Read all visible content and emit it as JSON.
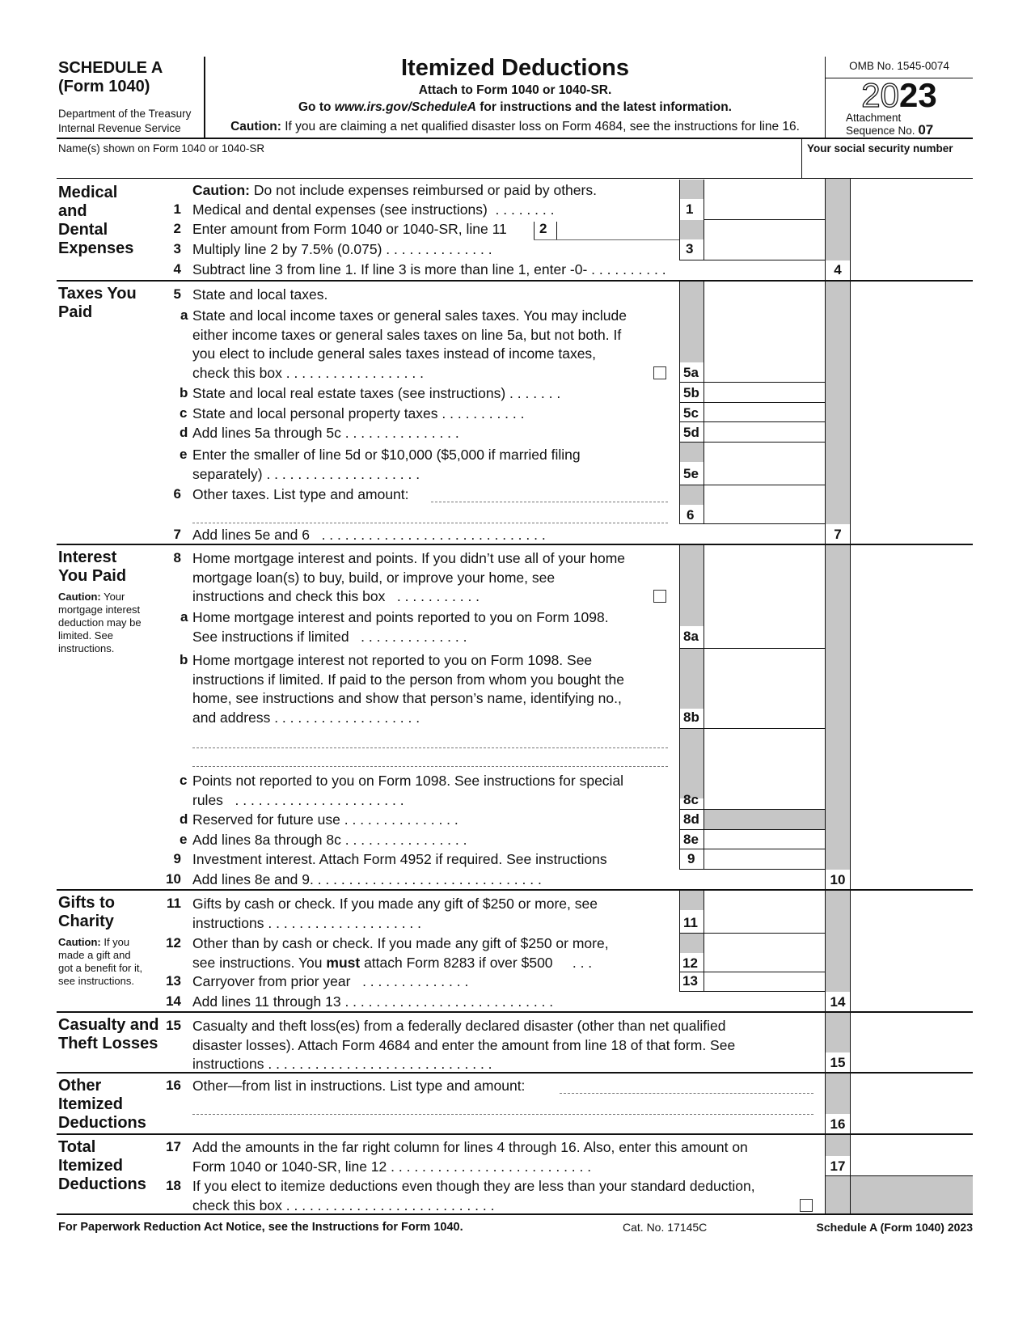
{
  "header": {
    "schedule": "SCHEDULE A",
    "form": "(Form 1040)",
    "dept1": "Department of the Treasury",
    "dept2": "Internal Revenue Service",
    "title": "Itemized Deductions",
    "attach": "Attach to Form 1040 or 1040-SR.",
    "goto_pre": "Go to ",
    "goto_url": "www.irs.gov/ScheduleA",
    "goto_post": " for instructions and the latest information.",
    "caution_label": "Caution:",
    "caution_text": " If you are claiming a net qualified disaster loss on Form 4684, see the instructions for line 16.",
    "omb": "OMB No. 1545-0074",
    "year_outline": "20",
    "year_bold": "23",
    "attachment": "Attachment",
    "sequence_label": "Sequence No.",
    "sequence_no": "07"
  },
  "name_row": {
    "name_label": "Name(s) shown on Form 1040 or 1040-SR",
    "name_value": "",
    "ssn_label": "Your social security number",
    "ssn_value": ""
  },
  "sections": {
    "medical": {
      "title": [
        "Medical",
        "and",
        "Dental",
        "Expenses"
      ],
      "caution_label": "Caution:",
      "caution_text": " Do not include expenses reimbursed or paid by others.",
      "l1": "Medical and dental expenses (see instructions)",
      "l2": "Enter amount from Form 1040 or 1040-SR, line 11",
      "l3": "Multiply line 2 by 7.5% (0.075)",
      "l4": "Subtract line 3 from line 1. If line 3 is more than line 1, enter -0-"
    },
    "taxes": {
      "title": [
        "Taxes You",
        "Paid"
      ],
      "l5": "State and local taxes.",
      "l5a": [
        "State and local income taxes or general sales taxes. You may include",
        "either income taxes or general sales taxes on line 5a, but not both. If",
        "you elect to include general sales taxes instead of income taxes,",
        "check this box"
      ],
      "l5b": "State and local real estate taxes (see instructions)",
      "l5c": "State and local personal property taxes",
      "l5d": "Add lines 5a through 5c",
      "l5e": [
        "Enter the smaller of line 5d or $10,000 ($5,000 if married filing",
        "separately)"
      ],
      "l6": "Other taxes. List type and amount:",
      "l7": "Add lines 5e and 6"
    },
    "interest": {
      "title": [
        "Interest",
        "You Paid"
      ],
      "caution_label": "Caution:",
      "caution_lines": [
        " Your",
        "mortgage interest",
        "deduction may be",
        "limited. See",
        "instructions."
      ],
      "l8": [
        "Home mortgage interest and points. If you didn’t use all of your home",
        "mortgage loan(s) to buy, build, or improve your home, see",
        "instructions and check this box"
      ],
      "l8a": [
        "Home mortgage interest and points reported to you on Form 1098.",
        "See instructions if limited"
      ],
      "l8b": [
        "Home mortgage interest not reported to you on Form 1098. See",
        "instructions if limited. If paid to the person from whom you bought the",
        "home, see instructions and show that person’s name, identifying no.,",
        "and address"
      ],
      "l8c": [
        "Points not reported to you on Form 1098. See instructions for special",
        "rules"
      ],
      "l8d": "Reserved for future use",
      "l8e": "Add lines 8a through 8c",
      "l9": "Investment interest. Attach Form 4952 if required. See instructions",
      "l10": "Add lines 8e and 9"
    },
    "gifts": {
      "title": [
        "Gifts to",
        "Charity"
      ],
      "caution_label": "Caution:",
      "caution_lines": [
        " If you",
        "made a gift and",
        "got a benefit for it,",
        "see instructions."
      ],
      "l11": [
        "Gifts by cash or check. If you made any gift of $250 or more, see",
        "instructions"
      ],
      "l12_a": "Other than by cash or check. If you made any gift of $250 or more,",
      "l12_b_pre": "see instructions. You ",
      "l12_b_bold": "must",
      "l12_b_post": " attach Form 8283 if over $500",
      "l13": "Carryover from prior year",
      "l14": "Add lines 11 through 13"
    },
    "casualty": {
      "title": [
        "Casualty and",
        "Theft Losses"
      ],
      "l15": [
        "Casualty and theft loss(es) from a federally declared disaster (other than net qualified",
        "disaster losses). Attach Form 4684 and enter the amount from line 18 of that form. See",
        "instructions"
      ]
    },
    "other": {
      "title": [
        "Other",
        "Itemized",
        "Deductions"
      ],
      "l16": "Other—from list in instructions. List type and amount:"
    },
    "total": {
      "title": [
        "Total",
        "Itemized",
        "Deductions"
      ],
      "l17": [
        "Add the amounts in the far right column for lines 4 through 16. Also, enter this amount on",
        "Form 1040 or 1040-SR, line 12"
      ],
      "l18": [
        "If you elect to itemize deductions even though they are less than your standard deduction,",
        "check this box"
      ]
    }
  },
  "line_numbers": {
    "n1": "1",
    "n2": "2",
    "n3": "3",
    "n4": "4",
    "n5": "5",
    "n6": "6",
    "n7": "7",
    "n8": "8",
    "n9": "9",
    "n10": "10",
    "n11": "11",
    "n12": "12",
    "n13": "13",
    "n14": "14",
    "n15": "15",
    "n16": "16",
    "n17": "17",
    "n18": "18",
    "a": "a",
    "b": "b",
    "c": "c",
    "d": "d",
    "e": "e",
    "b5a": "5a",
    "b5b": "5b",
    "b5c": "5c",
    "b5d": "5d",
    "b5e": "5e",
    "b8a": "8a",
    "b8b": "8b",
    "b8c": "8c",
    "b8d": "8d",
    "b8e": "8e"
  },
  "dots": {
    "d1": ". . . . . . . .",
    "d3": ". . . . . . . . . . . . . .",
    "d4": ". . . . . . . . . .",
    "d5a": ". . . . . . . . . . . . . . . . . .",
    "d5b": ". . . . . . .",
    "d5c": ". . . . . . . . . . .",
    "d5d": ". . . . . . . . . . . . . . .",
    "d5e": ". . . . . . . . . . . . . . . . . . . .",
    "d7": ". . . . . . . . . . . . . . . . . . . . . . . . . . . . .",
    "d8": ". . . . . . . . . . .",
    "d8a": ". . . . . . . . . . . . . .",
    "d8b": ". . . . . . . . . . . . . . . . . . .",
    "d8c": ". . . . . . . . . . . . . . . . . . . . . .",
    "d8d": ". . . . . . . . . . . . . . .",
    "d8e": ". . . . . . . . . . . . . . . .",
    "d10": ". . . . . . . . . . . . . . . . . . . . . . . . . . . . . .",
    "d11": ". . . . . . . . . . . . . . . . . . . .",
    "d12": ". . .",
    "d13": ". . . . . . . . . . . . . .",
    "d14": ". . . . . . . . . . . . . . . . . . . . . . . . . . .",
    "d15": ". . . . . . . . . . . . . . . . . . . . . . . . . . . . .",
    "d17": ". . . . . . . . . . . . . . . . . . . . . . . . . .",
    "d18": ". . . . . . . . . . . . . . . . . . . . . . . . . . ."
  },
  "checkboxes": {
    "line5a_sales_tax": false,
    "line8_limited": false,
    "line18_elect_itemize": false
  },
  "footer": {
    "paperwork": "For Paperwork Reduction Act Notice, see the Instructions for Form 1040.",
    "cat_no": "Cat. No. 17145C",
    "form_id": "Schedule A (Form 1040) 2023"
  }
}
